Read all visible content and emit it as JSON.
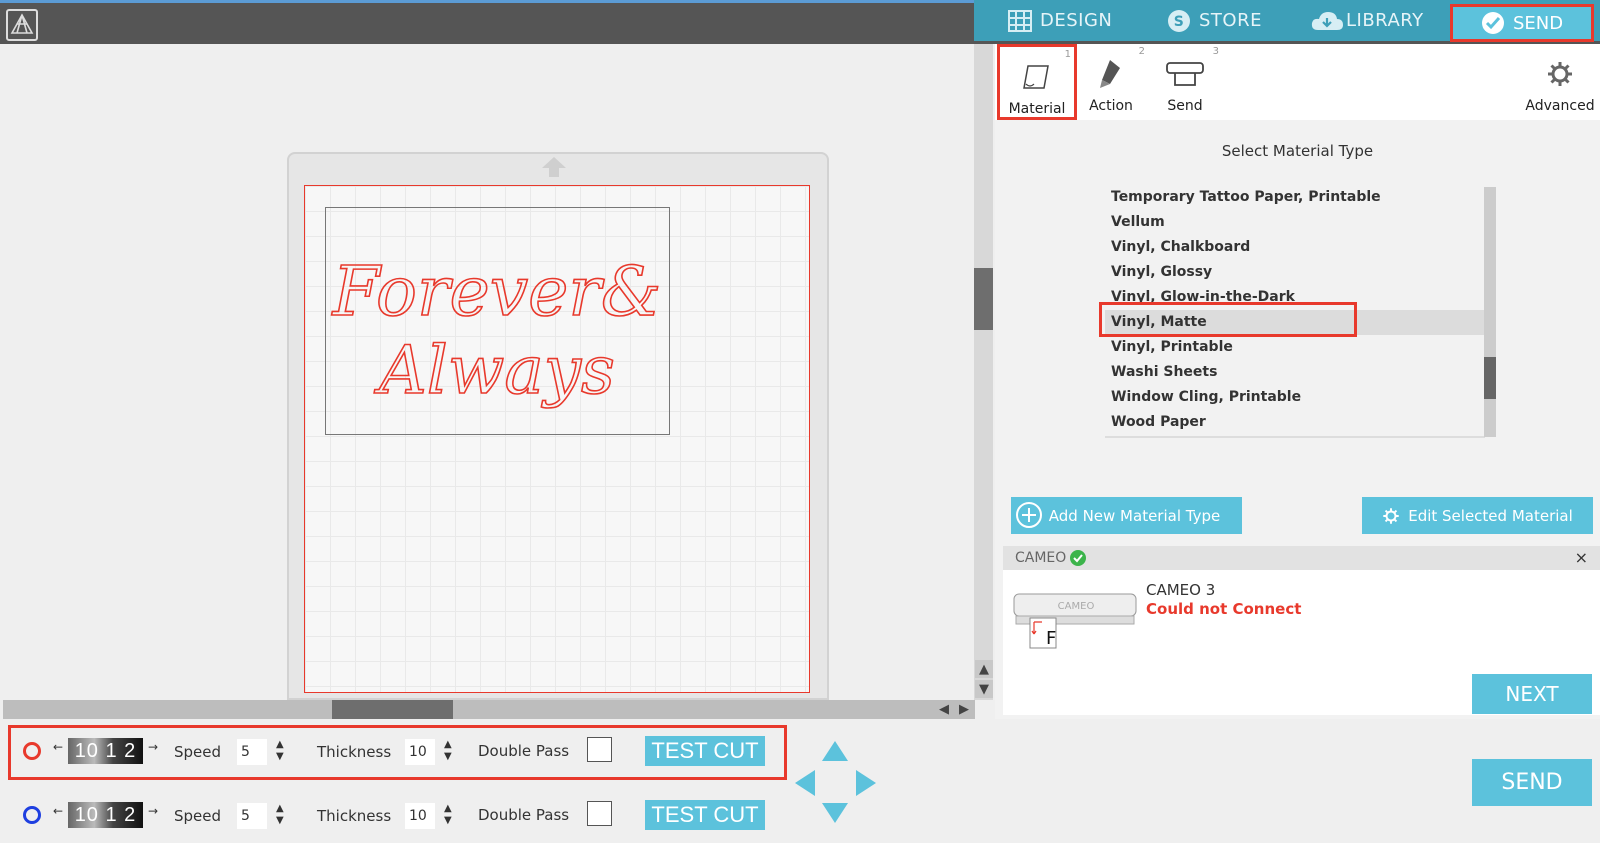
{
  "nav": {
    "tabs": [
      {
        "label": "DESIGN",
        "icon": "grid-icon"
      },
      {
        "label": "STORE",
        "icon": "store-icon"
      },
      {
        "label": "LIBRARY",
        "icon": "cloud-icon"
      },
      {
        "label": "SEND",
        "icon": "check-circle-icon"
      }
    ]
  },
  "steps": {
    "items": [
      {
        "label": "Material",
        "num": "1",
        "icon": "material-icon"
      },
      {
        "label": "Action",
        "num": "2",
        "icon": "blade-icon"
      },
      {
        "label": "Send",
        "num": "3",
        "icon": "machine-icon"
      }
    ],
    "advanced_label": "Advanced"
  },
  "design": {
    "line1": "Forever&",
    "line2": "Always"
  },
  "material": {
    "title": "Select Material Type",
    "items": [
      "Temporary Tattoo Paper, Printable",
      "Vellum",
      "Vinyl, Chalkboard",
      "Vinyl, Glossy",
      "Vinyl, Glow-in-the-Dark",
      "Vinyl, Matte",
      "Vinyl, Printable",
      "Washi Sheets",
      "Window Cling, Printable",
      "Wood Paper"
    ],
    "selected": "Vinyl, Matte",
    "add_label": "Add New Material Type",
    "edit_label": "Edit Selected Material"
  },
  "device": {
    "bar_label": "CAMEO",
    "name": "CAMEO 3",
    "status": "Could not Connect",
    "close": "×",
    "image_text": "CAMEO",
    "image_letter": "F"
  },
  "buttons": {
    "next": "NEXT",
    "send": "SEND"
  },
  "tools": [
    {
      "color": "#e8392c",
      "blade": "10 1 2",
      "speed_label": "Speed",
      "speed": "5",
      "thickness_label": "Thickness",
      "thickness": "10",
      "double_pass_label": "Double Pass",
      "test_cut": "TEST CUT"
    },
    {
      "color": "#1e3fe0",
      "blade": "10 1 2",
      "speed_label": "Speed",
      "speed": "5",
      "thickness_label": "Thickness",
      "thickness": "10",
      "double_pass_label": "Double Pass",
      "test_cut": "TEST CUT"
    }
  ],
  "colors": {
    "accent": "#5cc2dc",
    "highlight_red": "#e8392c",
    "nav_bg": "#3d9fb8"
  }
}
